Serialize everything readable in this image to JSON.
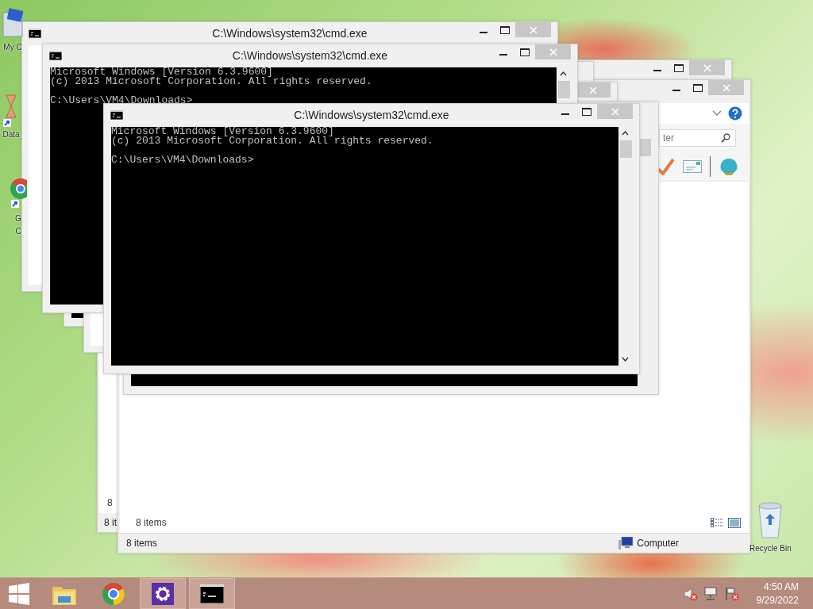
{
  "desktop": {
    "icons": [
      {
        "kind": "computer",
        "lines": [
          "My C"
        ]
      },
      {
        "kind": "shortcut",
        "lines": [
          "Data"
        ]
      },
      {
        "kind": "chrome",
        "lines": [
          "G",
          "C"
        ]
      },
      {
        "kind": "recycle",
        "lines": [
          "Recycle Bin"
        ]
      }
    ]
  },
  "windows": [
    {
      "kind": "explorer",
      "minimize_button": true,
      "maximize_button": true,
      "close_button": true,
      "content_text": "8",
      "status_text": "8 it"
    },
    {
      "kind": "explorer_main",
      "minimize_button": true,
      "maximize_button": true,
      "close_button": true,
      "search_placeholder": "ter",
      "info_text": "8 items",
      "status_text": "8 items",
      "location": "Computer"
    },
    {
      "kind": "console"
    },
    {
      "kind": "blank",
      "close_button": true
    },
    {
      "kind": "console"
    },
    {
      "kind": "blank",
      "title": "C:\\Windows\\system32\\cmd.exe",
      "minimize_button": true,
      "maximize_button": true,
      "close_button": true
    },
    {
      "kind": "console",
      "title": "C:\\Windows\\system32\\cmd.exe",
      "minimize_button": true,
      "maximize_button": true,
      "close_button": true,
      "scroll_up": true,
      "lines": [
        "Microsoft Windows [Version 6.3.9600]",
        "(c) 2013 Microsoft Corporation. All rights reserved."
      ],
      "prompt": "C:\\Users\\VM4\\Downloads>"
    },
    {
      "kind": "console",
      "title": "C:\\Windows\\system32\\cmd.exe",
      "minimize_button": true,
      "maximize_button": true,
      "close_button": true,
      "scroll_up": true,
      "scroll_down": true,
      "lines": [
        "Microsoft Windows [Version 6.3.9600]",
        "(c) 2013 Microsoft Corporation. All rights reserved."
      ],
      "prompt": "C:\\Users\\VM4\\Downloads>"
    }
  ],
  "taskbar": {
    "items": [
      {
        "kind": "start",
        "open": false
      },
      {
        "kind": "explorer",
        "open": false
      },
      {
        "kind": "chrome",
        "open": false
      },
      {
        "kind": "settings",
        "open": true
      },
      {
        "kind": "console",
        "open": true
      }
    ],
    "clock": {
      "time": "4:50 AM",
      "date": "9/29/2022"
    }
  }
}
